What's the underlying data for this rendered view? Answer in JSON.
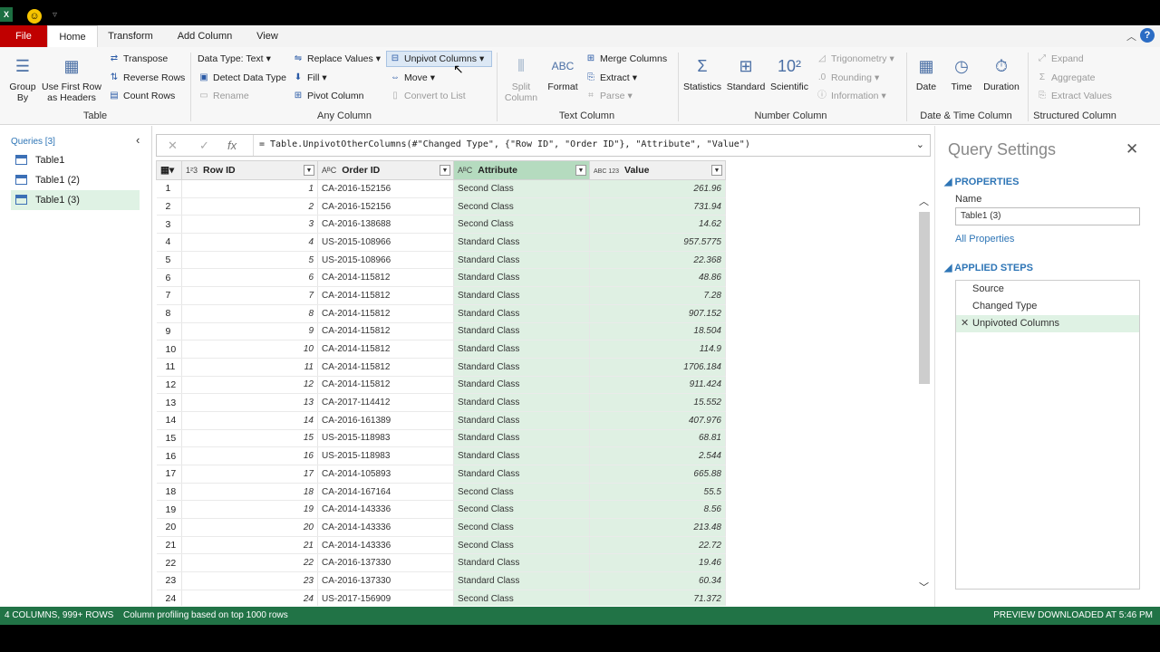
{
  "tabs": {
    "file": "File",
    "home": "Home",
    "transform": "Transform",
    "add_column": "Add Column",
    "view": "View"
  },
  "ribbon": {
    "group_by": "Group\nBy",
    "use_first_row": "Use First Row\nas Headers",
    "transpose": "Transpose",
    "reverse_rows": "Reverse Rows",
    "count_rows": "Count Rows",
    "data_type": "Data Type: Text",
    "detect_data_type": "Detect Data Type",
    "rename": "Rename",
    "replace_values": "Replace Values",
    "fill": "Fill",
    "pivot_column": "Pivot Column",
    "unpivot_columns": "Unpivot Columns",
    "move": "Move",
    "convert_to_list": "Convert to List",
    "split_column": "Split\nColumn",
    "format": "Format",
    "merge_columns": "Merge Columns",
    "extract": "Extract",
    "parse": "Parse",
    "statistics": "Statistics",
    "standard": "Standard",
    "scientific": "Scientific",
    "trigonometry": "Trigonometry",
    "rounding": "Rounding",
    "information": "Information",
    "date": "Date",
    "time": "Time",
    "duration": "Duration",
    "expand": "Expand",
    "aggregate": "Aggregate",
    "extract_values": "Extract Values",
    "groups": {
      "table": "Table",
      "any_column": "Any Column",
      "text_column": "Text Column",
      "number_column": "Number Column",
      "date_time_column": "Date & Time Column",
      "structured_column": "Structured Column"
    }
  },
  "queries": {
    "title": "Queries [3]",
    "items": [
      {
        "label": "Table1"
      },
      {
        "label": "Table1 (2)"
      },
      {
        "label": "Table1 (3)"
      }
    ]
  },
  "formula_bar": {
    "fx": "fx",
    "formula": "= Table.UnpivotOtherColumns(#\"Changed Type\", {\"Row ID\", \"Order ID\"}, \"Attribute\", \"Value\")"
  },
  "table": {
    "columns": [
      {
        "type": "1²3",
        "name": "Row ID"
      },
      {
        "type": "AᴮC",
        "name": "Order ID"
      },
      {
        "type": "AᴮC",
        "name": "Attribute"
      },
      {
        "type": "ABC\n123",
        "name": "Value"
      }
    ],
    "rows": [
      [
        "1",
        "CA-2016-152156",
        "Second Class",
        "261.96"
      ],
      [
        "2",
        "CA-2016-152156",
        "Second Class",
        "731.94"
      ],
      [
        "3",
        "CA-2016-138688",
        "Second Class",
        "14.62"
      ],
      [
        "4",
        "US-2015-108966",
        "Standard Class",
        "957.5775"
      ],
      [
        "5",
        "US-2015-108966",
        "Standard Class",
        "22.368"
      ],
      [
        "6",
        "CA-2014-115812",
        "Standard Class",
        "48.86"
      ],
      [
        "7",
        "CA-2014-115812",
        "Standard Class",
        "7.28"
      ],
      [
        "8",
        "CA-2014-115812",
        "Standard Class",
        "907.152"
      ],
      [
        "9",
        "CA-2014-115812",
        "Standard Class",
        "18.504"
      ],
      [
        "10",
        "CA-2014-115812",
        "Standard Class",
        "114.9"
      ],
      [
        "11",
        "CA-2014-115812",
        "Standard Class",
        "1706.184"
      ],
      [
        "12",
        "CA-2014-115812",
        "Standard Class",
        "911.424"
      ],
      [
        "13",
        "CA-2017-114412",
        "Standard Class",
        "15.552"
      ],
      [
        "14",
        "CA-2016-161389",
        "Standard Class",
        "407.976"
      ],
      [
        "15",
        "US-2015-118983",
        "Standard Class",
        "68.81"
      ],
      [
        "16",
        "US-2015-118983",
        "Standard Class",
        "2.544"
      ],
      [
        "17",
        "CA-2014-105893",
        "Standard Class",
        "665.88"
      ],
      [
        "18",
        "CA-2014-167164",
        "Second Class",
        "55.5"
      ],
      [
        "19",
        "CA-2014-143336",
        "Second Class",
        "8.56"
      ],
      [
        "20",
        "CA-2014-143336",
        "Second Class",
        "213.48"
      ],
      [
        "21",
        "CA-2014-143336",
        "Second Class",
        "22.72"
      ],
      [
        "22",
        "CA-2016-137330",
        "Standard Class",
        "19.46"
      ],
      [
        "23",
        "CA-2016-137330",
        "Standard Class",
        "60.34"
      ],
      [
        "24",
        "US-2017-156909",
        "Second Class",
        "71.372"
      ]
    ]
  },
  "settings": {
    "title": "Query Settings",
    "properties": "PROPERTIES",
    "name_label": "Name",
    "name_value": "Table1 (3)",
    "all_properties": "All Properties",
    "applied_steps": "APPLIED STEPS",
    "steps": [
      {
        "label": "Source"
      },
      {
        "label": "Changed Type"
      },
      {
        "label": "Unpivoted Columns"
      }
    ]
  },
  "status": {
    "columns_rows": "4 COLUMNS, 999+ ROWS",
    "profiling": "Column profiling based on top 1000 rows",
    "preview": "PREVIEW DOWNLOADED AT 5:46 PM"
  },
  "colors": {
    "accent_green": "#217346",
    "file_red": "#c00000",
    "selected_column": "#dff0e3"
  }
}
